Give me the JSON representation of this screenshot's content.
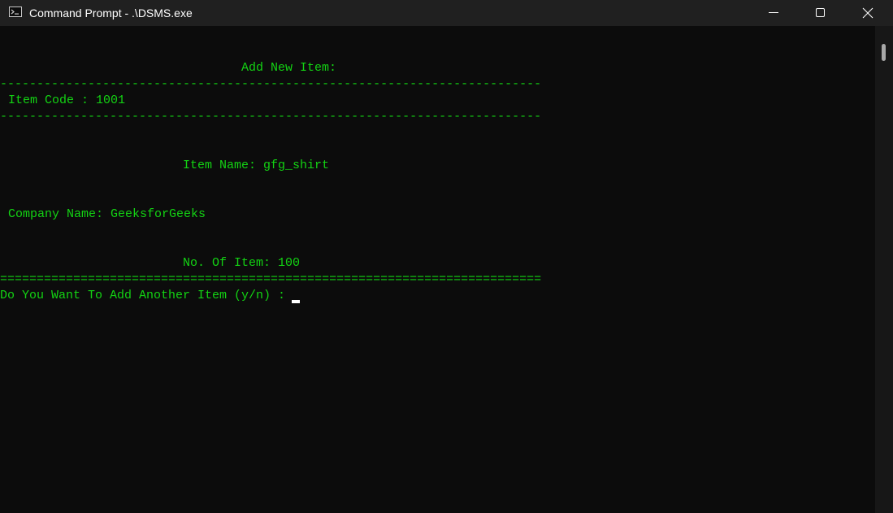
{
  "window": {
    "title": "Command Prompt - .\\DSMS.exe",
    "icon": "cmd-icon",
    "controls": [
      "minimize-icon",
      "maximize-icon",
      "close-icon"
    ]
  },
  "console": {
    "heading": "Add New Item:",
    "dash_rule": "--------------------------------------------------------------------------",
    "item_code_line": "Item Code : 1001",
    "item_name_line": "Item Name: gfg_shirt",
    "company_name_line": "Company Name: GeeksforGeeks",
    "quantity_line": "No. Of Item: 100",
    "equals_rule": "==========================================================================",
    "prompt_line": "Do You Want To Add Another Item (y/n) :"
  },
  "colors": {
    "console_text": "#13d313",
    "console_bg": "#0c0c0c",
    "titlebar_bg": "#202020"
  }
}
